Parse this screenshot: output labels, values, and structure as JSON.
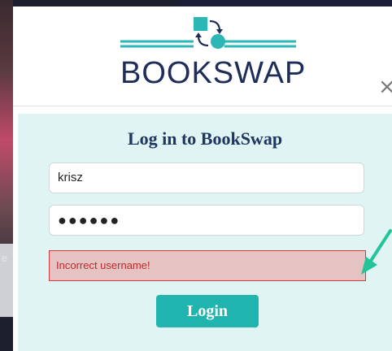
{
  "brand": {
    "name": "BOOKSWAP",
    "colors": {
      "teal": "#2bb7b5",
      "navy": "#1f2d5a"
    }
  },
  "dialog": {
    "close_icon": "×",
    "title": "Log in to BookSwap",
    "username": {
      "value": "krisz"
    },
    "password": {
      "masked_value": "●●●●●●"
    },
    "error_message": "Incorrect username!",
    "login_label": "Login"
  },
  "background": {
    "edge_text": "e"
  },
  "icons": {
    "logo": "book-swap-logo-icon",
    "close": "close-icon",
    "annotation": "arrow-pointer-icon"
  }
}
